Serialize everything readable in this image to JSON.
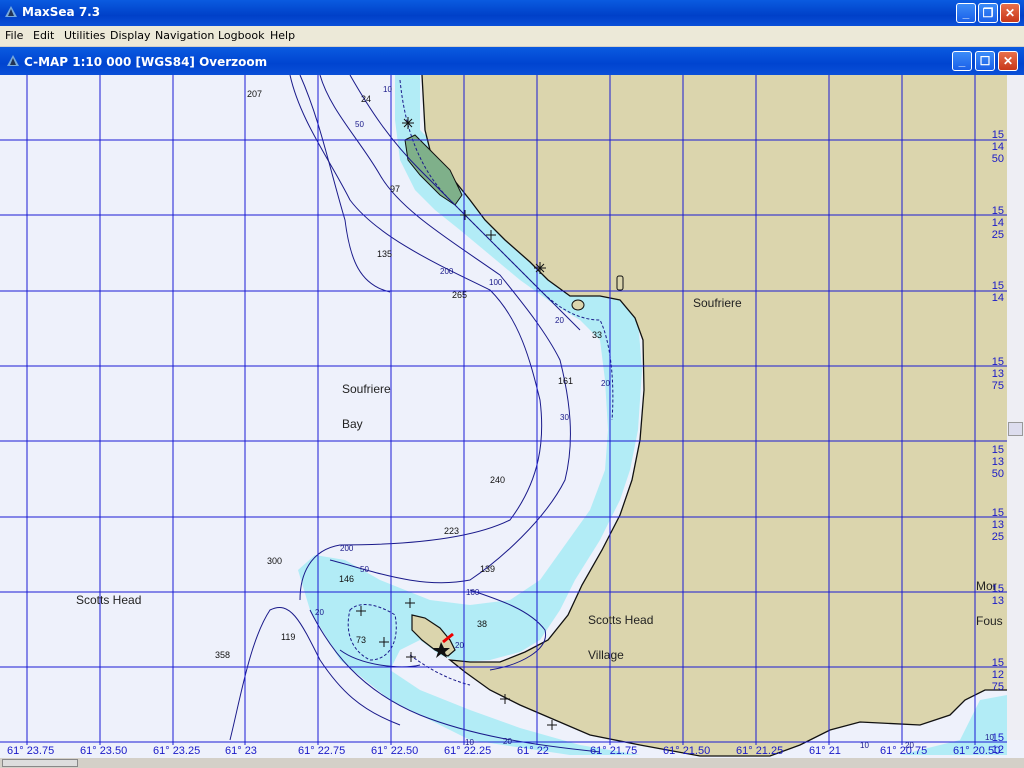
{
  "window": {
    "title": "MaxSea 7.3"
  },
  "menu": [
    "File",
    "Edit",
    "Utilities",
    "Display",
    "Navigation",
    "Logbook",
    "Help"
  ],
  "chart_window": {
    "title": "C-MAP  1:10 000 [WGS84]    Overzoom"
  },
  "place_labels": {
    "soufriere_town": "Soufriere",
    "bay_line1": "Soufriere",
    "bay_line2": "Bay",
    "scotts_head": "Scotts Head",
    "scotts_village_1": "Scotts Head",
    "scotts_village_2": "Village",
    "edge_1": "Mor",
    "edge_2": "Fous"
  },
  "depths": [
    "207",
    "24",
    "97",
    "135",
    "265",
    "33",
    "161",
    "240",
    "223",
    "139",
    "300",
    "146",
    "119",
    "73",
    "358",
    "38"
  ],
  "contour_labels": [
    "10",
    "50",
    "200",
    "100",
    "20",
    "20",
    "30",
    "200",
    "50",
    "100",
    "20",
    "20",
    "10",
    "20",
    "10",
    "20",
    "10"
  ],
  "lon_labels": [
    "61° 23.75",
    "61° 23.50",
    "61° 23.25",
    "61° 23",
    "61° 22.75",
    "61° 22.50",
    "61° 22.25",
    "61° 22",
    "61° 21.75",
    "61° 21.50",
    "61° 21.25",
    "61° 21",
    "61° 20.75",
    "61° 20.50"
  ],
  "lat_labels": [
    [
      "15",
      "14",
      "50"
    ],
    [
      "15",
      "14",
      "25"
    ],
    [
      "15",
      "14"
    ],
    [
      "15",
      "13",
      "75"
    ],
    [
      "15",
      "13",
      "50"
    ],
    [
      "15",
      "13",
      "25"
    ],
    [
      "15",
      "13"
    ],
    [
      "15",
      "12",
      "75"
    ],
    [
      "15",
      "12"
    ]
  ],
  "colors": {
    "land": "#dbd5ad",
    "shallow": "#b2ecf6",
    "deep": "#eef1fb",
    "grid": "#1a1ad4",
    "contour": "#1a1a8a",
    "text": "#1a1ac8",
    "titlebar": "#0a52db"
  }
}
